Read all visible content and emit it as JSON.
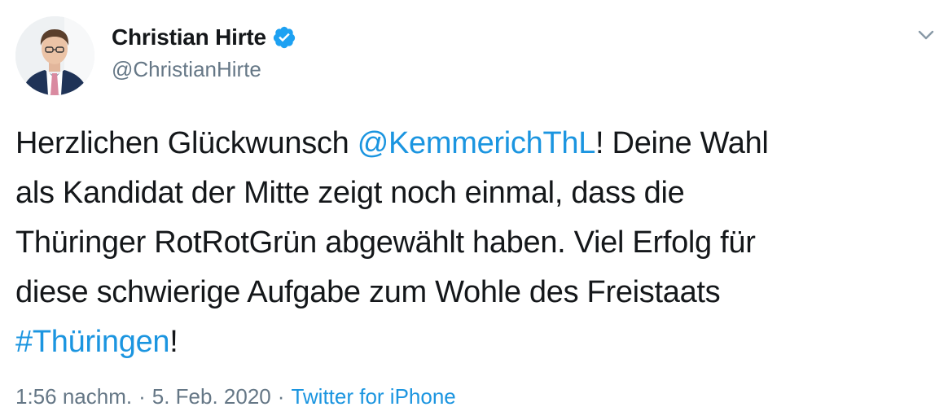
{
  "author": {
    "display_name": "Christian Hirte",
    "handle": "@ChristianHirte",
    "verified": true,
    "avatar_icon": "profile-photo"
  },
  "menu": {
    "icon": "chevron-down-icon"
  },
  "tweet": {
    "line1": {
      "pre": "Herzlichen Glückwunsch ",
      "mention": "@KemmerichThL",
      "post": "! Deine Wahl"
    },
    "line2": "als Kandidat der Mitte zeigt noch einmal, dass die",
    "line3": "Thüringer RotRotGrün abgewählt haben. Viel Erfolg für",
    "line4": "diese schwierige Aufgabe zum Wohle des Freistaats",
    "line5": {
      "hashtag": "#Thüringen",
      "post": "!"
    }
  },
  "meta": {
    "time": "1:56 nachm.",
    "separator": "·",
    "date": "5. Feb. 2020",
    "source": "Twitter for iPhone"
  },
  "colors": {
    "link": "#1b95e0",
    "text": "#14171a",
    "secondary": "#657786",
    "verified": "#1da1f2"
  }
}
